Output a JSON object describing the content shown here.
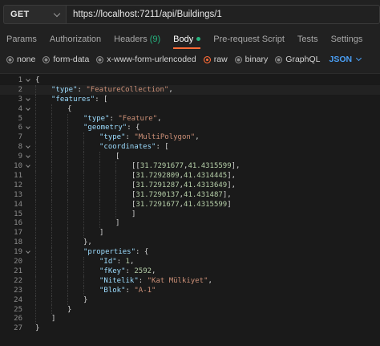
{
  "request": {
    "method": "GET",
    "url": "https://localhost:7211/api/Buildings/1"
  },
  "tabs": [
    {
      "label": "Params"
    },
    {
      "label": "Authorization"
    },
    {
      "label": "Headers",
      "count": "(9)"
    },
    {
      "label": "Body",
      "active": true
    },
    {
      "label": "Pre-request Script"
    },
    {
      "label": "Tests"
    },
    {
      "label": "Settings"
    }
  ],
  "body_types": [
    {
      "label": "none"
    },
    {
      "label": "form-data"
    },
    {
      "label": "x-www-form-urlencoded"
    },
    {
      "label": "raw",
      "checked": true
    },
    {
      "label": "binary"
    },
    {
      "label": "GraphQL"
    }
  ],
  "format": "JSON",
  "colors": {
    "accent": "#ff6c37",
    "link": "#4a9ff5",
    "ok": "#26b47f"
  },
  "editor": {
    "lines": [
      {
        "n": "1",
        "fold": true,
        "indent": 0,
        "tokens": [
          [
            "p",
            "{"
          ]
        ]
      },
      {
        "n": "2",
        "indent": 1,
        "tokens": [
          [
            "k",
            "\"type\""
          ],
          [
            "p",
            ": "
          ],
          [
            "s",
            "\"FeatureCollection\""
          ],
          [
            "p",
            ","
          ]
        ]
      },
      {
        "n": "3",
        "fold": true,
        "indent": 1,
        "tokens": [
          [
            "k",
            "\"features\""
          ],
          [
            "p",
            ": ["
          ]
        ]
      },
      {
        "n": "4",
        "fold": true,
        "indent": 2,
        "tokens": [
          [
            "p",
            "{"
          ]
        ]
      },
      {
        "n": "5",
        "indent": 3,
        "tokens": [
          [
            "k",
            "\"type\""
          ],
          [
            "p",
            ": "
          ],
          [
            "s",
            "\"Feature\""
          ],
          [
            "p",
            ","
          ]
        ]
      },
      {
        "n": "6",
        "fold": true,
        "indent": 3,
        "tokens": [
          [
            "k",
            "\"geometry\""
          ],
          [
            "p",
            ": {"
          ]
        ]
      },
      {
        "n": "7",
        "indent": 4,
        "tokens": [
          [
            "k",
            "\"type\""
          ],
          [
            "p",
            ": "
          ],
          [
            "s",
            "\"MultiPolygon\""
          ],
          [
            "p",
            ","
          ]
        ]
      },
      {
        "n": "8",
        "fold": true,
        "indent": 4,
        "tokens": [
          [
            "k",
            "\"coordinates\""
          ],
          [
            "p",
            ": ["
          ]
        ]
      },
      {
        "n": "9",
        "fold": true,
        "indent": 5,
        "tokens": [
          [
            "p",
            "["
          ]
        ]
      },
      {
        "n": "10",
        "fold": true,
        "indent": 6,
        "tokens": [
          [
            "p",
            "[["
          ],
          [
            "n",
            "31.7291677"
          ],
          [
            "p",
            ","
          ],
          [
            "n",
            "41.4315599"
          ],
          [
            "p",
            "],"
          ]
        ]
      },
      {
        "n": "11",
        "indent": 6,
        "tokens": [
          [
            "p",
            "["
          ],
          [
            "n",
            "31.7292809"
          ],
          [
            "p",
            ","
          ],
          [
            "n",
            "41.4314445"
          ],
          [
            "p",
            "],"
          ]
        ]
      },
      {
        "n": "12",
        "indent": 6,
        "tokens": [
          [
            "p",
            "["
          ],
          [
            "n",
            "31.7291287"
          ],
          [
            "p",
            ","
          ],
          [
            "n",
            "41.4313649"
          ],
          [
            "p",
            "],"
          ]
        ]
      },
      {
        "n": "13",
        "indent": 6,
        "tokens": [
          [
            "p",
            "["
          ],
          [
            "n",
            "31.7290137"
          ],
          [
            "p",
            ","
          ],
          [
            "n",
            "41.431487"
          ],
          [
            "p",
            "],"
          ]
        ]
      },
      {
        "n": "14",
        "indent": 6,
        "tokens": [
          [
            "p",
            "["
          ],
          [
            "n",
            "31.7291677"
          ],
          [
            "p",
            ","
          ],
          [
            "n",
            "41.4315599"
          ],
          [
            "p",
            "]"
          ]
        ]
      },
      {
        "n": "15",
        "indent": 6,
        "tokens": [
          [
            "p",
            "]"
          ]
        ]
      },
      {
        "n": "16",
        "indent": 5,
        "tokens": [
          [
            "p",
            "]"
          ]
        ]
      },
      {
        "n": "17",
        "indent": 4,
        "tokens": [
          [
            "p",
            "]"
          ]
        ]
      },
      {
        "n": "18",
        "indent": 3,
        "tokens": [
          [
            "p",
            "},"
          ]
        ]
      },
      {
        "n": "19",
        "fold": true,
        "indent": 3,
        "tokens": [
          [
            "k",
            "\"properties\""
          ],
          [
            "p",
            ": {"
          ]
        ]
      },
      {
        "n": "20",
        "indent": 4,
        "tokens": [
          [
            "k",
            "\"Id\""
          ],
          [
            "p",
            ": "
          ],
          [
            "n",
            "1"
          ],
          [
            "p",
            ","
          ]
        ]
      },
      {
        "n": "21",
        "indent": 4,
        "tokens": [
          [
            "k",
            "\"fKey\""
          ],
          [
            "p",
            ": "
          ],
          [
            "n",
            "2592"
          ],
          [
            "p",
            ","
          ]
        ]
      },
      {
        "n": "22",
        "indent": 4,
        "tokens": [
          [
            "k",
            "\"Nitelik\""
          ],
          [
            "p",
            ": "
          ],
          [
            "s",
            "\"Kat Mülkiyet\""
          ],
          [
            "p",
            ","
          ]
        ]
      },
      {
        "n": "23",
        "indent": 4,
        "tokens": [
          [
            "k",
            "\"Blok\""
          ],
          [
            "p",
            ": "
          ],
          [
            "s",
            "\"A-1\""
          ]
        ]
      },
      {
        "n": "24",
        "indent": 3,
        "tokens": [
          [
            "p",
            "}"
          ]
        ]
      },
      {
        "n": "25",
        "indent": 2,
        "tokens": [
          [
            "p",
            "}"
          ]
        ]
      },
      {
        "n": "26",
        "indent": 1,
        "tokens": [
          [
            "p",
            "]"
          ]
        ]
      },
      {
        "n": "27",
        "indent": 0,
        "tokens": [
          [
            "p",
            "}"
          ]
        ]
      }
    ]
  }
}
